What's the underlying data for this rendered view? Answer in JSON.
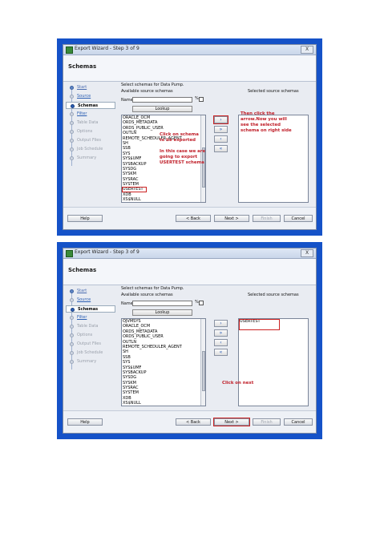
{
  "window": {
    "title": "Export Wizard - Step 3 of 9",
    "close_label": "X"
  },
  "header": {
    "title": "Schemas"
  },
  "nav": [
    {
      "label": "Start",
      "state": "done"
    },
    {
      "label": "Source",
      "state": "link"
    },
    {
      "label": "Schemas",
      "state": "active"
    },
    {
      "label": "Filter",
      "state": "link"
    },
    {
      "label": "Table Data",
      "state": "disabled"
    },
    {
      "label": "Options",
      "state": "disabled"
    },
    {
      "label": "Output Files",
      "state": "disabled"
    },
    {
      "label": "Job Schedule",
      "state": "disabled"
    },
    {
      "label": "Summary",
      "state": "disabled"
    }
  ],
  "content": {
    "instruction": "Select schemas for Data Pump.",
    "available_label": "Available source schemas",
    "selected_label": "Selected source schemas",
    "name_label": "Name",
    "name_value": "",
    "percent": "%",
    "lookup_label": "Lookup"
  },
  "buttons": {
    "help": "Help",
    "back": "< Back",
    "next": "Next >",
    "finish": "Finish",
    "cancel": "Cancel"
  },
  "arrows": {
    "move_right": "›",
    "move_all_right": "»",
    "move_left": "‹",
    "move_all_left": "«"
  },
  "screen1": {
    "available": [
      "ORACLE_OCM",
      "ORDS_METADATA",
      "ORDS_PUBLIC_USER",
      "OUTLN",
      "REMOTE_SCHEDULER_AGENT",
      "SH",
      "SSB",
      "SYS",
      "SYSBACKUP",
      "SYS$UMF",
      "SYSBACKUP",
      "SYSDG",
      "SYSKM",
      "SYSRAC",
      "SYSTEM",
      "USERTEST",
      "XDB",
      "XS$NULL"
    ],
    "selected": [],
    "note1": "Click on schema\nto be exported",
    "note2": "In this case we are\ngoing to export\nUSERTEST schema",
    "note3": "Then click the\narrow.Now you will\nsee the selected\nschema on right side"
  },
  "screen2": {
    "available": [
      "OJVMSYS",
      "ORACLE_OCM",
      "ORDS_METADATA",
      "ORDS_PUBLIC_USER",
      "OUTLN",
      "REMOTE_SCHEDULER_AGENT",
      "SH",
      "SSB",
      "SYS",
      "SYS$UMF",
      "SYSBACKUP",
      "SYSDG",
      "SYSKM",
      "SYSRAC",
      "SYSTEM",
      "XDB",
      "XS$NULL"
    ],
    "selected": [
      "USERTEST"
    ],
    "note1": "Click on next"
  }
}
